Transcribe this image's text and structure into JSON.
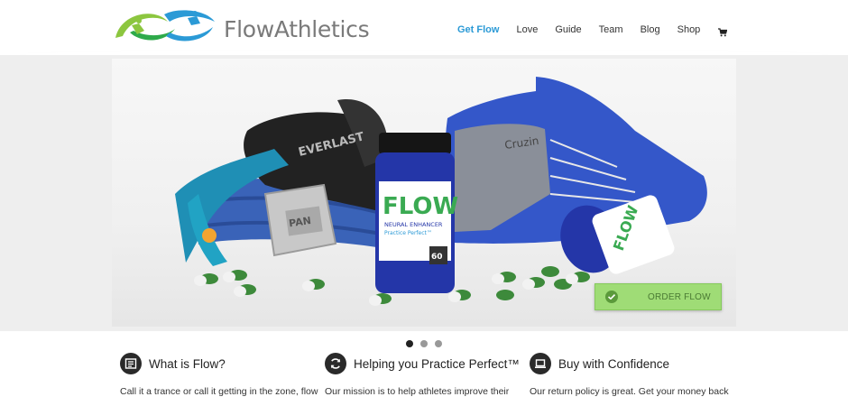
{
  "brand": {
    "name": "FlowAthletics",
    "colors": {
      "green": "#8cc63f",
      "blue": "#2b9ad6"
    }
  },
  "nav": {
    "items": [
      {
        "label": "Get Flow",
        "active": true
      },
      {
        "label": "Love"
      },
      {
        "label": "Guide"
      },
      {
        "label": "Team"
      },
      {
        "label": "Blog"
      },
      {
        "label": "Shop"
      }
    ],
    "cart_icon": "shopping-cart-icon"
  },
  "hero": {
    "cta_label": "ORDER FLOW",
    "cta_icon": "check-circle-icon",
    "product_brand": "FLOW",
    "product_subtitle": "NEURAL ENHANCER",
    "product_tagline": "Practice Perfect™",
    "product_count": "60",
    "medal_text": "PAN",
    "glove_text": "EVERLAST",
    "slider": {
      "slides": 3,
      "current": 1
    }
  },
  "features": [
    {
      "icon": "newspaper-icon",
      "title": "What is Flow?",
      "text": "Call it a trance or call it getting in the zone, flow"
    },
    {
      "icon": "refresh-icon",
      "title": "Helping you Practice Perfect™",
      "text": "Our mission is to help athletes improve their"
    },
    {
      "icon": "laptop-icon",
      "title": "Buy with Confidence",
      "text": "Our return policy is great. Get your money back"
    }
  ]
}
